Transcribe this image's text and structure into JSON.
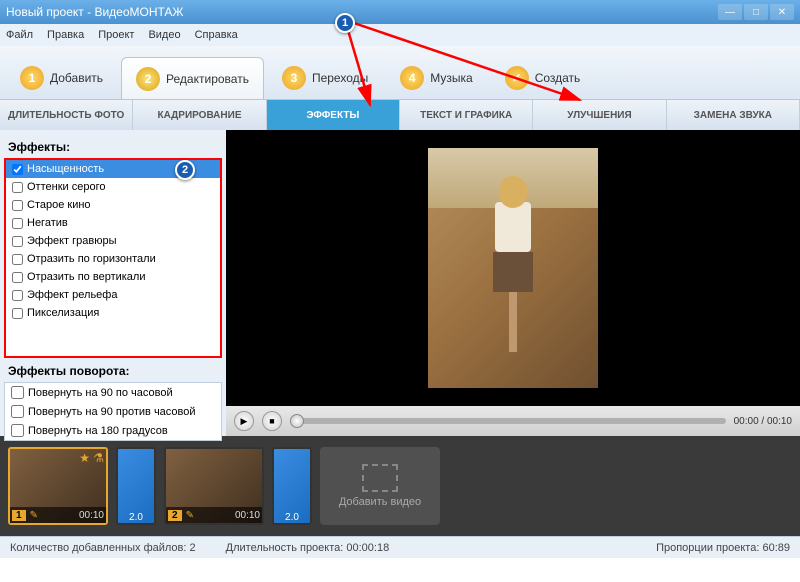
{
  "window": {
    "title": "Новый проект - ВидеоМОНТАЖ"
  },
  "menu": [
    "Файл",
    "Правка",
    "Проект",
    "Видео",
    "Справка"
  ],
  "maintabs": [
    {
      "num": "1",
      "label": "Добавить"
    },
    {
      "num": "2",
      "label": "Редактировать"
    },
    {
      "num": "3",
      "label": "Переходы"
    },
    {
      "num": "4",
      "label": "Музыка"
    },
    {
      "num": "5",
      "label": "Создать"
    }
  ],
  "subtabs": [
    "ДЛИТЕЛЬНОСТЬ ФОТО",
    "КАДРИРОВАНИЕ",
    "ЭФФЕКТЫ",
    "ТЕКСТ И ГРАФИКА",
    "УЛУЧШЕНИЯ",
    "ЗАМЕНА ЗВУКА"
  ],
  "sidebar": {
    "effects_title": "Эффекты:",
    "effects": [
      {
        "label": "Насыщенность",
        "checked": true,
        "selected": true
      },
      {
        "label": "Оттенки серого",
        "checked": false
      },
      {
        "label": "Старое кино",
        "checked": false
      },
      {
        "label": "Негатив",
        "checked": false
      },
      {
        "label": "Эффект гравюры",
        "checked": false
      },
      {
        "label": "Отразить по горизонтали",
        "checked": false
      },
      {
        "label": "Отразить по вертикали",
        "checked": false
      },
      {
        "label": "Эффект рельефа",
        "checked": false
      },
      {
        "label": "Пикселизация",
        "checked": false
      }
    ],
    "rotate_title": "Эффекты поворота:",
    "rotate": [
      "Повернуть на 90 по часовой",
      "Повернуть на 90 против часовой",
      "Повернуть на 180 градусов"
    ]
  },
  "player": {
    "time": "00:00 / 00:10"
  },
  "timeline": {
    "clips": [
      {
        "num": "1",
        "dur": "00:10"
      },
      {
        "trans": "2.0"
      },
      {
        "num": "2",
        "dur": "00:10"
      },
      {
        "trans": "2.0"
      }
    ],
    "add_label": "Добавить видео"
  },
  "status": {
    "files_label": "Количество добавленных файлов:",
    "files": "2",
    "duration_label": "Длительность проекта:",
    "duration": "00:00:18",
    "ratio_label": "Пропорции проекта:",
    "ratio": "60:89"
  },
  "annotations": {
    "b1": "1",
    "b2": "2"
  }
}
